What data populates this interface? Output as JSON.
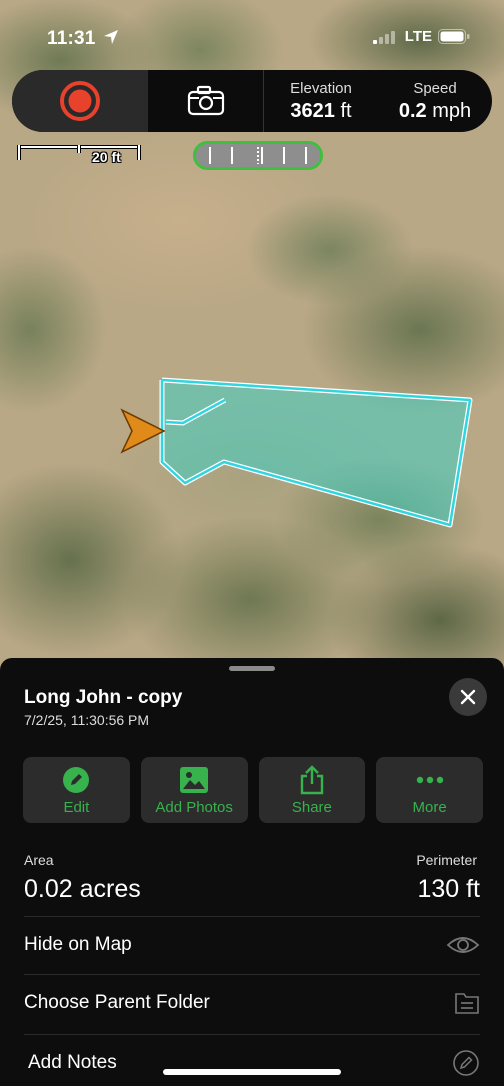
{
  "status_bar": {
    "time": "11:31",
    "network": "LTE"
  },
  "top_bar": {
    "record_icon": "record-icon",
    "camera_icon": "camera-icon",
    "elevation_label": "Elevation",
    "elevation_value": "3621",
    "elevation_unit": "ft",
    "speed_label": "Speed",
    "speed_value": "0.2",
    "speed_unit": "mph"
  },
  "map": {
    "scale_label": "20 ft",
    "polygon_color": "#30d5e0",
    "marker_color": "#e08a1a"
  },
  "sheet": {
    "title": "Long John - copy",
    "date": "7/2/25, 11:30:56 PM",
    "actions": [
      {
        "label": "Edit",
        "icon": "pencil-icon"
      },
      {
        "label": "Add Photos",
        "icon": "image-icon"
      },
      {
        "label": "Share",
        "icon": "share-icon"
      },
      {
        "label": "More",
        "icon": "more-dots-icon"
      }
    ],
    "area_label": "Area",
    "area_value": "0.02 acres",
    "perimeter_label": "Perimeter",
    "perimeter_value": "130 ft",
    "rows": [
      {
        "label": "Hide on Map",
        "icon": "eye-icon"
      },
      {
        "label": "Choose Parent Folder",
        "icon": "folder-icon"
      },
      {
        "label": "Add Notes",
        "icon": "pencil-circle-icon"
      }
    ],
    "accent_color": "#37b24d"
  }
}
